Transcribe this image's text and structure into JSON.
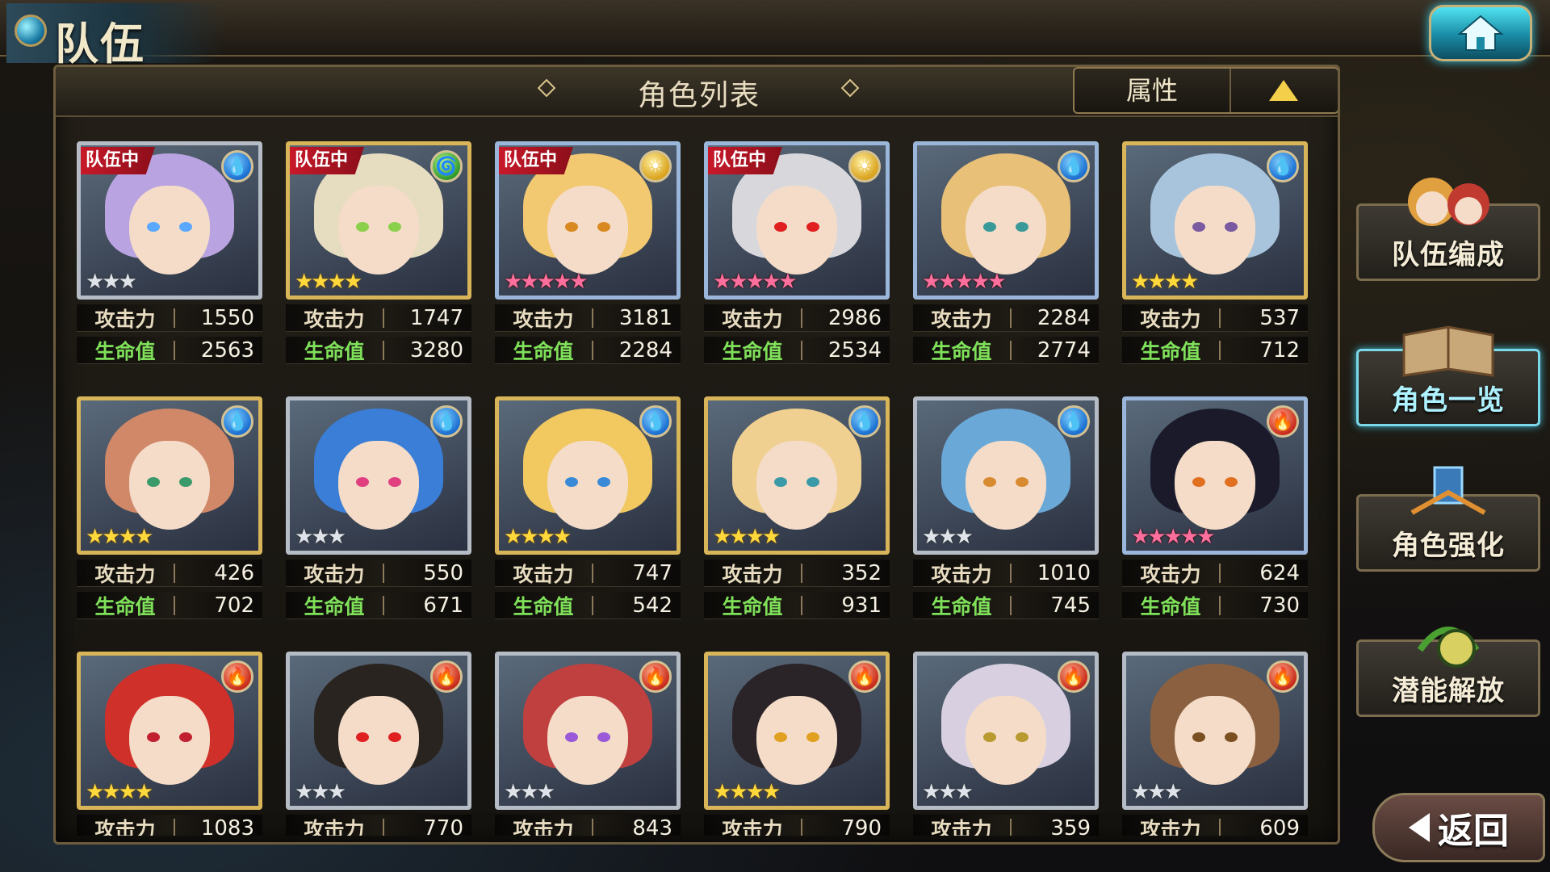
{
  "header": {
    "title": "队伍"
  },
  "panel": {
    "title": "角色列表",
    "sort_label": "属性"
  },
  "labels": {
    "atk": "攻击力",
    "hp": "生命值",
    "team_tag": "队伍中"
  },
  "menu": {
    "team_edit": "队伍编成",
    "char_list": "角色一览",
    "char_enhance": "角色强化",
    "potential": "潜能解放",
    "back": "返回"
  },
  "colors": {
    "accent": "#36c6df",
    "hp_label": "#7fe05a",
    "team_tag": "#c9192a",
    "gold_frame": "#d8b558"
  },
  "characters": [
    {
      "in_team": true,
      "element": "water",
      "stars": "★★★",
      "frame": "silver",
      "atk": "1550",
      "hp": "2563",
      "hair": "#b9a3e0",
      "eye": "#5aa8ff"
    },
    {
      "in_team": true,
      "element": "wind",
      "stars": "★★★★",
      "frame": "gold",
      "atk": "1747",
      "hp": "3280",
      "hair": "#e6dcc0",
      "eye": "#8ad04a"
    },
    {
      "in_team": true,
      "element": "light",
      "stars": "★★★★★",
      "frame": "rainbow",
      "atk": "3181",
      "hp": "2284",
      "hair": "#f2c870",
      "eye": "#d88a20"
    },
    {
      "in_team": true,
      "element": "light",
      "stars": "★★★★★",
      "frame": "rainbow",
      "atk": "2986",
      "hp": "2534",
      "hair": "#d8d8dc",
      "eye": "#e02020"
    },
    {
      "in_team": false,
      "element": "water",
      "stars": "★★★★★",
      "frame": "rainbow",
      "atk": "2284",
      "hp": "2774",
      "hair": "#e8c078",
      "eye": "#3a9a9a"
    },
    {
      "in_team": false,
      "element": "water",
      "stars": "★★★★",
      "frame": "gold",
      "atk": "537",
      "hp": "712",
      "hair": "#a8c4dc",
      "eye": "#7a5aa0"
    },
    {
      "in_team": false,
      "element": "water",
      "stars": "★★★★",
      "frame": "gold",
      "atk": "426",
      "hp": "702",
      "hair": "#d08868",
      "eye": "#3a9a6a"
    },
    {
      "in_team": false,
      "element": "water",
      "stars": "★★★",
      "frame": "silver",
      "atk": "550",
      "hp": "671",
      "hair": "#3a7ed8",
      "eye": "#e04080"
    },
    {
      "in_team": false,
      "element": "water",
      "stars": "★★★★",
      "frame": "gold",
      "atk": "747",
      "hp": "542",
      "hair": "#f2c860",
      "eye": "#3a8ad8"
    },
    {
      "in_team": false,
      "element": "water",
      "stars": "★★★★",
      "frame": "gold",
      "atk": "352",
      "hp": "931",
      "hair": "#f0d090",
      "eye": "#3a9aa8"
    },
    {
      "in_team": false,
      "element": "water",
      "stars": "★★★",
      "frame": "silver",
      "atk": "1010",
      "hp": "745",
      "hair": "#6aa8d8",
      "eye": "#d88a30"
    },
    {
      "in_team": false,
      "element": "fire",
      "stars": "★★★★★",
      "frame": "rainbow",
      "atk": "624",
      "hp": "730",
      "hair": "#1a1a2a",
      "eye": "#e07020"
    },
    {
      "in_team": false,
      "element": "fire",
      "stars": "★★★★",
      "frame": "gold",
      "atk": "1083",
      "hp": "",
      "hair": "#d0302a",
      "eye": "#c02030"
    },
    {
      "in_team": false,
      "element": "fire",
      "stars": "★★★",
      "frame": "silver",
      "atk": "770",
      "hp": "",
      "hair": "#2a2420",
      "eye": "#e02020"
    },
    {
      "in_team": false,
      "element": "fire",
      "stars": "★★★",
      "frame": "silver",
      "atk": "843",
      "hp": "",
      "hair": "#c04040",
      "eye": "#9a5ad8"
    },
    {
      "in_team": false,
      "element": "fire",
      "stars": "★★★★",
      "frame": "gold",
      "atk": "790",
      "hp": "",
      "hair": "#2a2428",
      "eye": "#e0a020"
    },
    {
      "in_team": false,
      "element": "fire",
      "stars": "★★★",
      "frame": "silver",
      "atk": "359",
      "hp": "",
      "hair": "#d8d0e0",
      "eye": "#b89a30"
    },
    {
      "in_team": false,
      "element": "fire",
      "stars": "★★★",
      "frame": "silver",
      "atk": "609",
      "hp": "",
      "hair": "#8a6040",
      "eye": "#7a5020"
    }
  ]
}
